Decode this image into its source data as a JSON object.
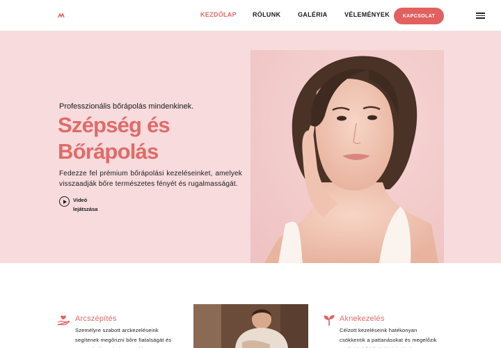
{
  "header": {
    "logo_label": "M",
    "nav": [
      {
        "label": "KEZDŐLAP",
        "active": true
      },
      {
        "label": "RÓLUNK",
        "active": false
      },
      {
        "label": "GALÉRIA",
        "active": false
      },
      {
        "label": "VÉLEMÉNYEK",
        "active": false
      }
    ],
    "cta_label": "KAPCSOLAT"
  },
  "hero": {
    "tagline": "Professzionális bőrápolás mindenkinek.",
    "headline_line1": "Szépség és",
    "headline_line2": "Bőrápolás",
    "description": "Fedezze fel prémium bőrápolási kezeléseinket, amelyek visszaadják bőre természetes fényét és rugalmasságát.",
    "video_label": "Videó lejátszása"
  },
  "services": [
    {
      "icon": "hand-heart-icon",
      "title": "Arcszépítés",
      "text": "Személyre szabott arckezeléseink segítenek megőrizni bőre fiatalságát és ragyogását a mindennapokban."
    },
    {
      "icon": "sprout-icon",
      "title": "Aknekezelés",
      "text": "Célzott kezeléseink hatékonyan csökkentik a pattanásokat és megelőzik az újabb bőrhibák kialakulását."
    }
  ],
  "colors": {
    "accent": "#e0615f",
    "hero_bg": "#f7dbdd",
    "heading": "#df6b68"
  }
}
